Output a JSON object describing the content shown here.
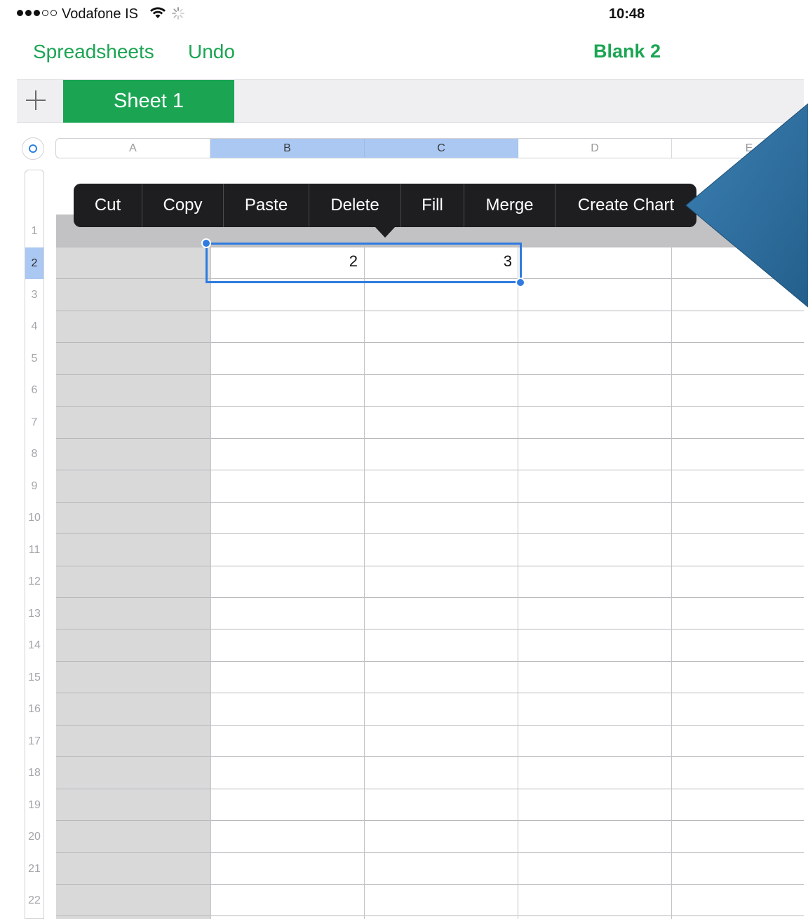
{
  "status_bar": {
    "carrier": "Vodafone IS",
    "time": "10:48",
    "signal_bars_filled": 3,
    "signal_bars_total": 5
  },
  "nav": {
    "back_label": "Spreadsheets",
    "undo_label": "Undo",
    "document_title": "Blank 2"
  },
  "tabs": {
    "sheets": [
      "Sheet 1"
    ],
    "active_sheet": "Sheet 1"
  },
  "columns": [
    "A",
    "B",
    "C",
    "D",
    "E"
  ],
  "selected_columns": [
    "B",
    "C"
  ],
  "rows": [
    "1",
    "2",
    "3",
    "4",
    "5",
    "6",
    "7",
    "8",
    "9",
    "10",
    "11",
    "12",
    "13",
    "14",
    "15",
    "16",
    "17",
    "18",
    "19",
    "20",
    "21",
    "22"
  ],
  "selected_row": "2",
  "cells": {
    "B2": "2",
    "C2": "3"
  },
  "context_menu": {
    "items": [
      "Cut",
      "Copy",
      "Paste",
      "Delete",
      "Fill",
      "Merge",
      "Create Chart"
    ]
  },
  "colors": {
    "accent_green": "#1ba553",
    "selection_blue": "#2f7be0",
    "pointer_blue": "#2f6e9e"
  },
  "icons": [
    "wifi-icon",
    "activity-spinner-icon",
    "add-sheet-icon",
    "select-all-icon"
  ]
}
